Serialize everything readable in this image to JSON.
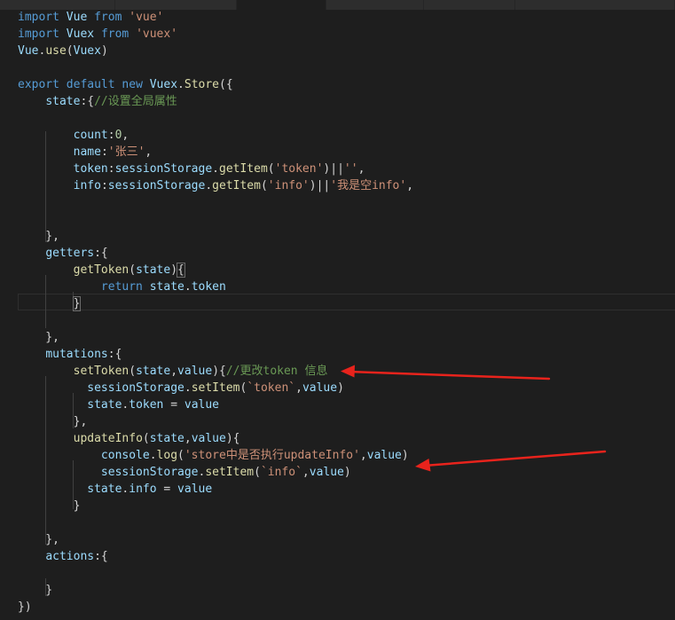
{
  "editor": {
    "lines": [
      [
        [
          "kw",
          "import"
        ],
        [
          "punc",
          " "
        ],
        [
          "var",
          "Vue"
        ],
        [
          "punc",
          " "
        ],
        [
          "kw",
          "from"
        ],
        [
          "punc",
          " "
        ],
        [
          "str",
          "'vue'"
        ]
      ],
      [
        [
          "kw",
          "import"
        ],
        [
          "punc",
          " "
        ],
        [
          "var",
          "Vuex"
        ],
        [
          "punc",
          " "
        ],
        [
          "kw",
          "from"
        ],
        [
          "punc",
          " "
        ],
        [
          "str",
          "'vuex'"
        ]
      ],
      [
        [
          "var",
          "Vue"
        ],
        [
          "punc",
          "."
        ],
        [
          "fn",
          "use"
        ],
        [
          "punc",
          "("
        ],
        [
          "var",
          "Vuex"
        ],
        [
          "punc",
          ")"
        ]
      ],
      [],
      [
        [
          "kw",
          "export"
        ],
        [
          "punc",
          " "
        ],
        [
          "kw",
          "default"
        ],
        [
          "punc",
          " "
        ],
        [
          "kw",
          "new"
        ],
        [
          "punc",
          " "
        ],
        [
          "var",
          "Vuex"
        ],
        [
          "punc",
          "."
        ],
        [
          "fn",
          "Store"
        ],
        [
          "punc",
          "({"
        ]
      ],
      [
        [
          "punc",
          "    "
        ],
        [
          "var",
          "state"
        ],
        [
          "punc",
          ":{"
        ],
        [
          "cmt",
          "//设置全局属性"
        ]
      ],
      [],
      [
        [
          "punc",
          "        "
        ],
        [
          "var",
          "count"
        ],
        [
          "punc",
          ":"
        ],
        [
          "num",
          "0"
        ],
        [
          "punc",
          ","
        ]
      ],
      [
        [
          "punc",
          "        "
        ],
        [
          "var",
          "name"
        ],
        [
          "punc",
          ":"
        ],
        [
          "str",
          "'张三'"
        ],
        [
          "punc",
          ","
        ]
      ],
      [
        [
          "punc",
          "        "
        ],
        [
          "var",
          "token"
        ],
        [
          "punc",
          ":"
        ],
        [
          "var",
          "sessionStorage"
        ],
        [
          "punc",
          "."
        ],
        [
          "fn",
          "getItem"
        ],
        [
          "punc",
          "("
        ],
        [
          "str",
          "'token'"
        ],
        [
          "punc",
          ")||"
        ],
        [
          "str",
          "''"
        ],
        [
          "punc",
          ","
        ]
      ],
      [
        [
          "punc",
          "        "
        ],
        [
          "var",
          "info"
        ],
        [
          "punc",
          ":"
        ],
        [
          "var",
          "sessionStorage"
        ],
        [
          "punc",
          "."
        ],
        [
          "fn",
          "getItem"
        ],
        [
          "punc",
          "("
        ],
        [
          "str",
          "'info'"
        ],
        [
          "punc",
          ")||"
        ],
        [
          "str",
          "'我是空info'"
        ],
        [
          "punc",
          ","
        ]
      ],
      [],
      [],
      [
        [
          "punc",
          "    },"
        ]
      ],
      [
        [
          "punc",
          "    "
        ],
        [
          "var",
          "getters"
        ],
        [
          "punc",
          ":{"
        ]
      ],
      [
        [
          "punc",
          "        "
        ],
        [
          "fn",
          "getToken"
        ],
        [
          "punc",
          "("
        ],
        [
          "var",
          "state"
        ],
        [
          "punc",
          ")"
        ],
        [
          "mark",
          "{"
        ]
      ],
      [
        [
          "punc",
          "            "
        ],
        [
          "kw",
          "return"
        ],
        [
          "punc",
          " "
        ],
        [
          "var",
          "state"
        ],
        [
          "punc",
          "."
        ],
        [
          "var",
          "token"
        ]
      ],
      [
        [
          "punc",
          "        "
        ],
        [
          "mark",
          "}"
        ]
      ],
      [],
      [
        [
          "punc",
          "    },"
        ]
      ],
      [
        [
          "punc",
          "    "
        ],
        [
          "var",
          "mutations"
        ],
        [
          "punc",
          ":{"
        ]
      ],
      [
        [
          "punc",
          "        "
        ],
        [
          "fn",
          "setToken"
        ],
        [
          "punc",
          "("
        ],
        [
          "var",
          "state"
        ],
        [
          "punc",
          ","
        ],
        [
          "var",
          "value"
        ],
        [
          "punc",
          "){"
        ],
        [
          "cmt",
          "//更改token 信息"
        ]
      ],
      [
        [
          "punc",
          "          "
        ],
        [
          "var",
          "sessionStorage"
        ],
        [
          "punc",
          "."
        ],
        [
          "fn",
          "setItem"
        ],
        [
          "punc",
          "("
        ],
        [
          "str",
          "`token`"
        ],
        [
          "punc",
          ","
        ],
        [
          "var",
          "value"
        ],
        [
          "punc",
          ")"
        ]
      ],
      [
        [
          "punc",
          "          "
        ],
        [
          "var",
          "state"
        ],
        [
          "punc",
          "."
        ],
        [
          "var",
          "token"
        ],
        [
          "punc",
          " = "
        ],
        [
          "var",
          "value"
        ]
      ],
      [
        [
          "punc",
          "        },"
        ]
      ],
      [
        [
          "punc",
          "        "
        ],
        [
          "fn",
          "updateInfo"
        ],
        [
          "punc",
          "("
        ],
        [
          "var",
          "state"
        ],
        [
          "punc",
          ","
        ],
        [
          "var",
          "value"
        ],
        [
          "punc",
          "){"
        ]
      ],
      [
        [
          "punc",
          "            "
        ],
        [
          "var",
          "console"
        ],
        [
          "punc",
          "."
        ],
        [
          "fn",
          "log"
        ],
        [
          "punc",
          "("
        ],
        [
          "str",
          "'store中是否执行updateInfo'"
        ],
        [
          "punc",
          ","
        ],
        [
          "var",
          "value"
        ],
        [
          "punc",
          ")"
        ]
      ],
      [
        [
          "punc",
          "            "
        ],
        [
          "var",
          "sessionStorage"
        ],
        [
          "punc",
          "."
        ],
        [
          "fn",
          "setItem"
        ],
        [
          "punc",
          "("
        ],
        [
          "str",
          "`info`"
        ],
        [
          "punc",
          ","
        ],
        [
          "var",
          "value"
        ],
        [
          "punc",
          ")"
        ]
      ],
      [
        [
          "punc",
          "          "
        ],
        [
          "var",
          "state"
        ],
        [
          "punc",
          "."
        ],
        [
          "var",
          "info"
        ],
        [
          "punc",
          " = "
        ],
        [
          "var",
          "value"
        ]
      ],
      [
        [
          "punc",
          "        }"
        ]
      ],
      [],
      [
        [
          "punc",
          "    },"
        ]
      ],
      [
        [
          "punc",
          "    "
        ],
        [
          "var",
          "actions"
        ],
        [
          "punc",
          ":{"
        ]
      ],
      [],
      [
        [
          "punc",
          "    }"
        ]
      ],
      [
        [
          "punc",
          "})"
        ]
      ]
    ]
  },
  "colors": {
    "background": "#1e1e1e",
    "keyword": "#569cd6",
    "function": "#dcdcaa",
    "variable": "#9cdcfe",
    "string": "#ce9178",
    "number": "#b5cea8",
    "comment": "#6a9955",
    "annotation_arrow": "#e8231c"
  }
}
